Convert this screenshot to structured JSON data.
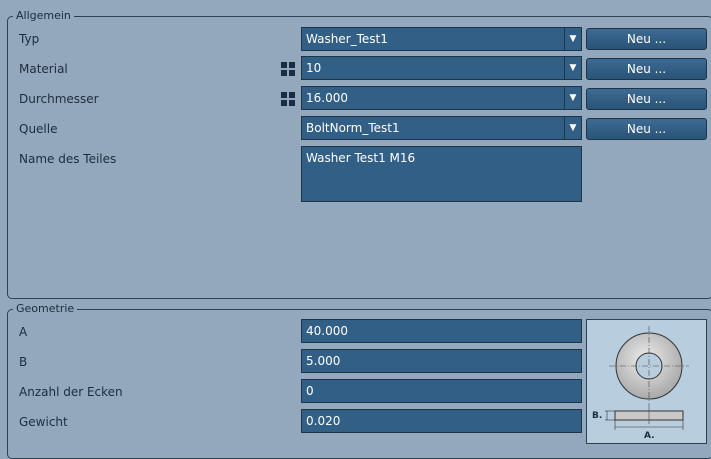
{
  "allgemein": {
    "title": "Allgemein",
    "rows": [
      {
        "label": "Typ",
        "value": "Washer_Test1",
        "button": "Neu ..."
      },
      {
        "label": "Material",
        "value": "10",
        "button": "Neu ..."
      },
      {
        "label": "Durchmesser",
        "value": "16.000",
        "button": "Neu ..."
      },
      {
        "label": "Quelle",
        "value": "BoltNorm_Test1",
        "button": "Neu ..."
      }
    ],
    "name_label": "Name des Teiles",
    "name_value": "Washer Test1 M16"
  },
  "geometrie": {
    "title": "Geometrie",
    "rows": [
      {
        "label": "A",
        "value": "40.000"
      },
      {
        "label": "B",
        "value": "5.000"
      },
      {
        "label": "Anzahl der Ecken",
        "value": "0"
      },
      {
        "label": "Gewicht",
        "value": "0.020"
      }
    ],
    "preview": {
      "dim_a": "A.",
      "dim_b": "B."
    }
  },
  "icons": {
    "dropdown": "chevron-down-icon",
    "material_selector": "grid-selector-icon",
    "diameter_selector": "grid-selector-icon"
  },
  "colors": {
    "background": "#93a8bd",
    "field": "#325f86",
    "border": "#1e3448"
  }
}
